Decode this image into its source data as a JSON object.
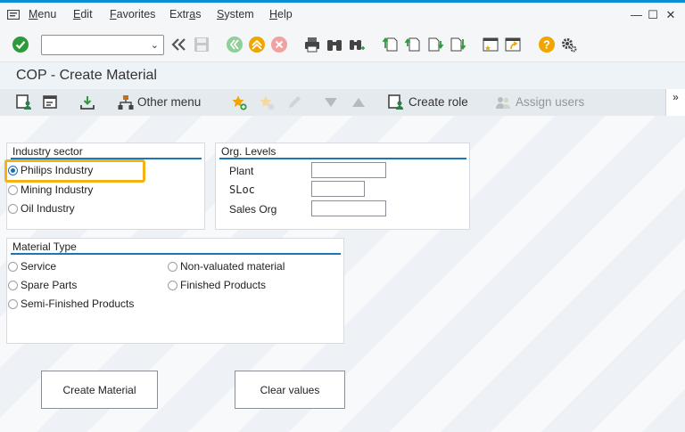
{
  "menubar": {
    "items": [
      {
        "u": "M",
        "rest": "enu"
      },
      {
        "u": "E",
        "rest": "dit"
      },
      {
        "u": "F",
        "rest": "avorites"
      },
      {
        "u": "",
        "pre": "Extr",
        "u2": "a",
        "rest2": "s"
      },
      {
        "u": "S",
        "rest": "ystem"
      },
      {
        "u": "H",
        "rest": "elp"
      }
    ],
    "window_buttons": [
      "—",
      "☐",
      "✕"
    ]
  },
  "toolbar": {
    "command_field_value": "",
    "dropdown_glyph": "⌄",
    "icons": [
      "enter-icon",
      "back-icon",
      "save-icon",
      "previous-icon",
      "exit-icon",
      "cancel-icon",
      "print-icon",
      "find-icon",
      "find-next-icon",
      "first-page-icon",
      "previous-page-icon",
      "next-page-icon",
      "last-page-icon",
      "new-session-icon",
      "shortcut-icon",
      "help-icon",
      "settings-icon"
    ]
  },
  "page": {
    "title": "COP - Create Material"
  },
  "app_toolbar": {
    "other_menu": "Other menu",
    "create_role": "Create role",
    "assign_users": "Assign users",
    "more": "»"
  },
  "industry_sector": {
    "title": "Industry sector",
    "options": [
      "Philips Industry",
      "Mining Industry",
      "Oil Industry"
    ],
    "selected": "Philips Industry"
  },
  "org_levels": {
    "title": "Org. Levels",
    "fields": [
      {
        "label": "Plant",
        "value": ""
      },
      {
        "label": "SLoc",
        "value": ""
      },
      {
        "label": "Sales Org",
        "value": ""
      }
    ]
  },
  "material_type": {
    "title": "Material Type",
    "options_left": [
      "Service",
      "Spare Parts",
      "Semi-Finished Products"
    ],
    "options_right": [
      "Non-valuated material",
      "Finished Products"
    ]
  },
  "buttons": {
    "create_material": "Create Material",
    "clear_values": "Clear values"
  },
  "colors": {
    "accent": "#0a8fd6",
    "highlight": "#f5b118",
    "group_line": "#1b78b6",
    "enter_green": "#2f9a3c",
    "help_orange": "#f0a500"
  }
}
